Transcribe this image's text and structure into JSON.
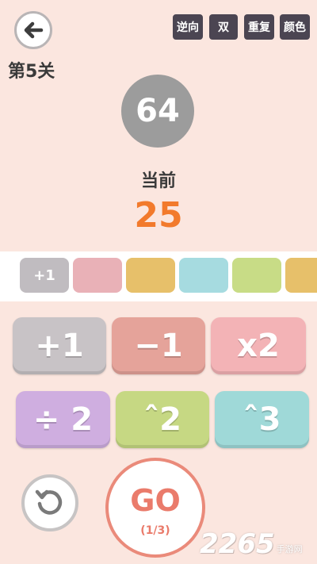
{
  "header": {
    "level_title": "第5关",
    "mode_buttons": [
      "逆向",
      "双",
      "重复",
      "颜色"
    ]
  },
  "target": {
    "value": "64"
  },
  "current": {
    "label": "当前",
    "value": "25"
  },
  "sequence": {
    "slots": [
      {
        "label": "+1",
        "color": "#c0bcc0"
      },
      {
        "label": "",
        "color": "#e9b1b7"
      },
      {
        "label": "",
        "color": "#e7c06a"
      },
      {
        "label": "",
        "color": "#a6dbe0"
      },
      {
        "label": "",
        "color": "#c8dc86"
      },
      {
        "label": "",
        "color": "#e7c06a"
      }
    ]
  },
  "operations": [
    {
      "label": "+1",
      "color": "#c8c3c6"
    },
    {
      "label": "−1",
      "color": "#e5a39a"
    },
    {
      "label": "x2",
      "color": "#f3b3b6"
    },
    {
      "label": "÷ 2",
      "color": "#cfaee0"
    },
    {
      "label": "ˆ2",
      "color": "#c6d883"
    },
    {
      "label": "ˆ3",
      "color": "#9fd9d8"
    }
  ],
  "controls": {
    "go_label": "GO",
    "go_progress": "(1/3)"
  },
  "watermark": {
    "number": "2265",
    "site": "手游网"
  },
  "icons": {
    "back": "arrow-left-icon",
    "reset": "undo-icon"
  }
}
